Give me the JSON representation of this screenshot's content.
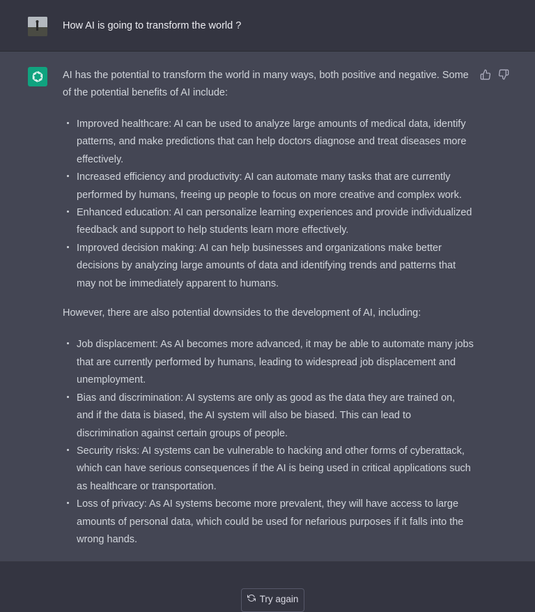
{
  "user": {
    "question": "How AI is going to transform the world ?"
  },
  "assistant": {
    "intro": "AI has the potential to transform the world in many ways, both positive and negative. Some of the potential benefits of AI include:",
    "benefits": [
      "Improved healthcare: AI can be used to analyze large amounts of medical data, identify patterns, and make predictions that can help doctors diagnose and treat diseases more effectively.",
      "Increased efficiency and productivity: AI can automate many tasks that are currently performed by humans, freeing up people to focus on more creative and complex work.",
      "Enhanced education: AI can personalize learning experiences and provide individualized feedback and support to help students learn more effectively.",
      "Improved decision making: AI can help businesses and organizations make better decisions by analyzing large amounts of data and identifying trends and patterns that may not be immediately apparent to humans."
    ],
    "downsides_intro": "However, there are also potential downsides to the development of AI, including:",
    "downsides": [
      "Job displacement: As AI becomes more advanced, it may be able to automate many jobs that are currently performed by humans, leading to widespread job displacement and unemployment.",
      "Bias and discrimination: AI systems are only as good as the data they are trained on, and if the data is biased, the AI system will also be biased. This can lead to discrimination against certain groups of people.",
      "Security risks: AI systems can be vulnerable to hacking and other forms of cyberattack, which can have serious consequences if the AI is being used in critical applications such as healthcare or transportation.",
      "Loss of privacy: As AI systems become more prevalent, they will have access to large amounts of personal data, which could be used for nefarious purposes if it falls into the wrong hands."
    ]
  },
  "controls": {
    "try_again_label": "Try again"
  },
  "icons": {
    "user_avatar": "user-photo-avatar",
    "assistant_avatar": "openai-logo-icon",
    "thumbs_up": "thumbs-up-icon",
    "thumbs_down": "thumbs-down-icon",
    "regenerate": "refresh-icon"
  },
  "colors": {
    "background": "#343541",
    "assistant_background": "#444654",
    "brand": "#10a37f",
    "text": "#d1d5db"
  }
}
